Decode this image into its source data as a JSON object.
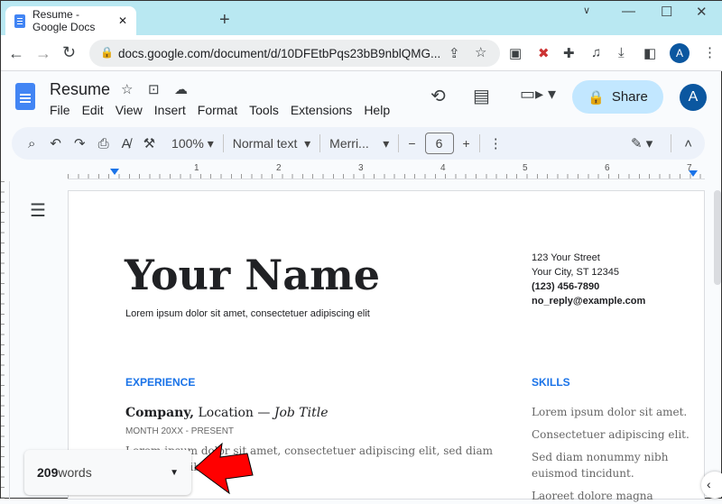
{
  "browser": {
    "tab_title": "Resume - Google Docs",
    "url": "docs.google.com/document/d/10DFEtbPqs23bB9nblQMG...",
    "avatar": "A"
  },
  "doc": {
    "title": "Resume",
    "menu": [
      "File",
      "Edit",
      "View",
      "Insert",
      "Format",
      "Tools",
      "Extensions",
      "Help"
    ],
    "share_label": "Share",
    "avatar": "A"
  },
  "toolbar": {
    "zoom": "100%",
    "style": "Normal text",
    "font": "Merri...",
    "font_size": "6"
  },
  "ruler": [
    "1",
    "2",
    "3",
    "4",
    "5",
    "6",
    "7"
  ],
  "resume": {
    "name": "Your Name",
    "tagline": "Lorem ipsum dolor sit amet, consectetuer adipiscing elit",
    "contact": [
      "123 Your Street",
      "Your City, ST 12345",
      "(123) 456-7890",
      "no_reply@example.com"
    ],
    "experience_heading": "EXPERIENCE",
    "company": "Company,",
    "location": " Location — ",
    "job_title": "Job Title",
    "dates": "MONTH 20XX - PRESENT",
    "exp_text": "Lorem ipsum dolor sit amet, consectetuer adipiscing elit, sed diam",
    "exp_text2": "nonummy nibh",
    "skills_heading": "SKILLS",
    "skills": [
      "Lorem ipsum dolor sit amet.",
      "Consectetuer adipiscing elit.",
      "Sed diam nonummy nibh",
      "euismod tincidunt.",
      "Laoreet dolore magna"
    ]
  },
  "word_count": {
    "number": "209",
    "label": " words"
  },
  "colors": {
    "accent": "#1a73e8",
    "share_bg": "#c2e7ff",
    "arrow": "#ff0000"
  }
}
